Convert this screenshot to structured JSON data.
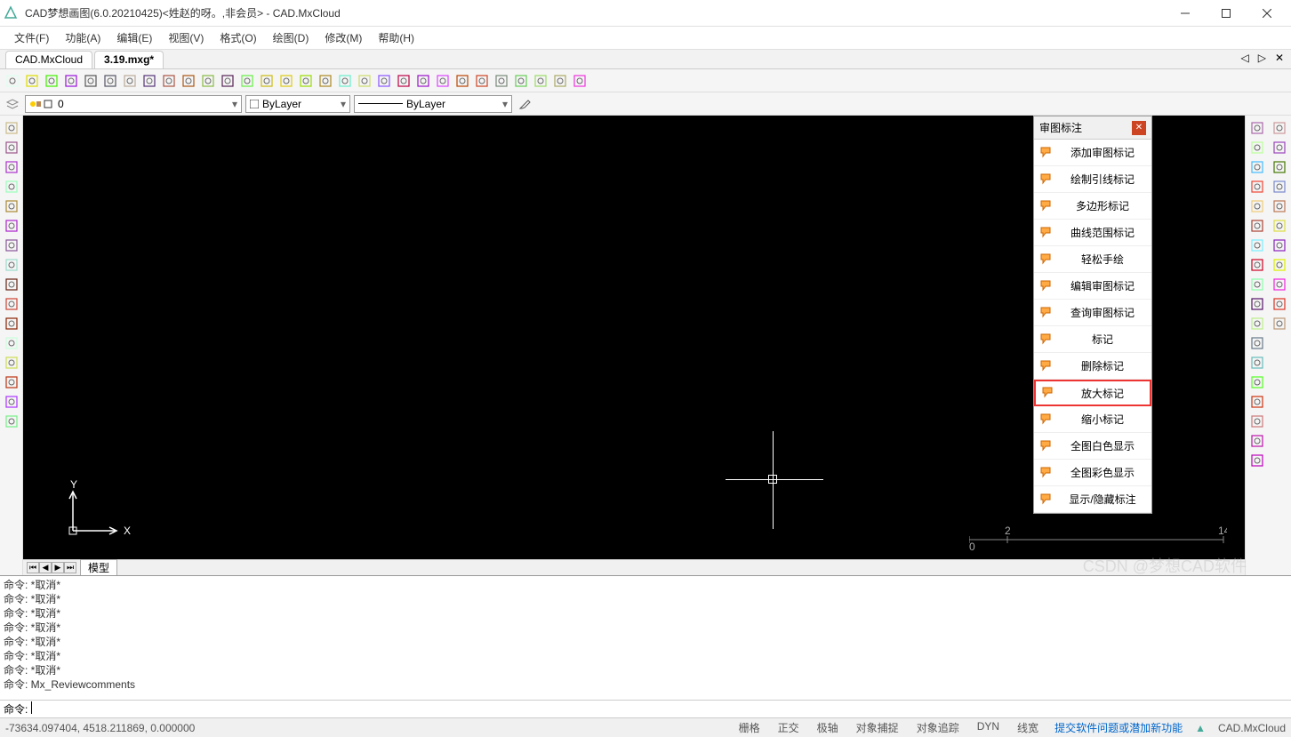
{
  "window": {
    "title": "CAD梦想画图(6.0.20210425)<姓赵的呀。,非会员> - CAD.MxCloud"
  },
  "menu": [
    "文件(F)",
    "功能(A)",
    "编辑(E)",
    "视图(V)",
    "格式(O)",
    "绘图(D)",
    "修改(M)",
    "帮助(H)"
  ],
  "doc_tabs": [
    "CAD.MxCloud",
    "3.19.mxg*"
  ],
  "active_doc": 1,
  "toolbar_icons": [
    "new",
    "open",
    "select",
    "save",
    "saveas",
    "preview",
    "zoom",
    "zoom-in",
    "zoom-out",
    "pan",
    "measure",
    "zoom-ext",
    "zoom-win",
    "zoom-prev",
    "move-target",
    "draw",
    "brush",
    "layers",
    "marker",
    "paste",
    "replace",
    "table",
    "image",
    "undo",
    "redo",
    "cloud",
    "globe",
    "search",
    "pdf",
    "settings"
  ],
  "layer_combo": {
    "value": "0"
  },
  "color_combo": {
    "value": "ByLayer"
  },
  "linetype_combo": {
    "value": "ByLayer"
  },
  "left_tools": [
    "line",
    "arc",
    "polygon",
    "rectangle",
    "curve",
    "circle-center",
    "spline",
    "ellipse",
    "revolve",
    "break",
    "extend",
    "block",
    "text",
    "table-tool",
    "vtext",
    "grid"
  ],
  "right_tools_col1": [
    "ruler",
    "copy",
    "array",
    "mirror",
    "rotate",
    "grid-snap",
    "text-style",
    "dim-style",
    "spline-tool",
    "chamfer",
    "fillet",
    "trim",
    "extend-r",
    "break-r",
    "explode",
    "offset",
    "scale",
    "stretch"
  ],
  "right_tools_col2": [
    "line-r",
    "rect-r",
    "copy-r",
    "rotate-r",
    "select-r",
    "move-r",
    "glue",
    "filter",
    "group",
    "ungroup",
    "match"
  ],
  "review_panel": {
    "title": "审图标注",
    "items": [
      {
        "icon": "flag-add",
        "label": "添加审图标记"
      },
      {
        "icon": "leader",
        "label": "绘制引线标记"
      },
      {
        "icon": "polygon-mark",
        "label": "多边形标记"
      },
      {
        "icon": "curve-mark",
        "label": "曲线范围标记"
      },
      {
        "icon": "freehand",
        "label": "轻松手绘"
      },
      {
        "icon": "edit-mark",
        "label": "编辑审图标记"
      },
      {
        "icon": "query-mark",
        "label": "查询审图标记"
      },
      {
        "icon": "pin",
        "label": "标记"
      },
      {
        "icon": "flag-del",
        "label": "删除标记"
      },
      {
        "icon": "zoom-big",
        "label": "放大标记",
        "highlight": true
      },
      {
        "icon": "zoom-small",
        "label": "缩小标记"
      },
      {
        "icon": "full-mono",
        "label": "全图白色显示"
      },
      {
        "icon": "full-color",
        "label": "全图彩色显示"
      },
      {
        "icon": "eye",
        "label": "显示/隐藏标注"
      }
    ]
  },
  "model_tab": "模型",
  "cmd_history": [
    "命令:  *取消*",
    "命令:  *取消*",
    "命令:  *取消*",
    "命令:  *取消*",
    "命令:  *取消*",
    "命令:  *取消*",
    "命令:  *取消*",
    "命令:  Mx_Reviewcomments"
  ],
  "cmd_prompt": "命令:",
  "scale": {
    "left": "0",
    "right_top": "14",
    "right_bottom": "2"
  },
  "ucs": {
    "y": "Y",
    "x": "X"
  },
  "status": {
    "coords": "-73634.097404,  4518.211869,  0.000000",
    "toggles": [
      "栅格",
      "正交",
      "极轴",
      "对象捕捉",
      "对象追踪",
      "DYN",
      "线宽"
    ],
    "link": "提交软件问题或潜加新功能",
    "right_app": "CAD.MxCloud"
  },
  "watermark": "CSDN @梦想CAD软件"
}
